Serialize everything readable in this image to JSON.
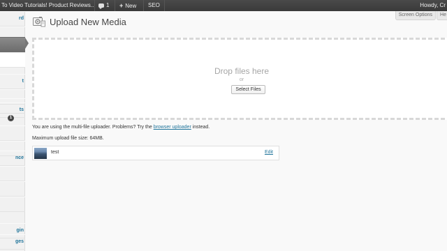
{
  "adminbar": {
    "site_title": "To Video Tutorials! Product Reviews...",
    "comments_count": "1",
    "new_label": "New",
    "seo_label": "SEO",
    "howdy": "Howdy, Cr"
  },
  "sidebar": {
    "items": [
      {
        "label": "rd"
      },
      {
        "label": ""
      },
      {
        "label": ""
      },
      {
        "label": ""
      },
      {
        "label": "t"
      },
      {
        "label": ""
      },
      {
        "label": ""
      },
      {
        "label": "ts"
      },
      {
        "label": ""
      },
      {
        "label": ""
      },
      {
        "label": "nce"
      },
      {
        "label": ""
      },
      {
        "label": ""
      },
      {
        "label": ""
      },
      {
        "label": "gin"
      },
      {
        "label": "ges"
      }
    ],
    "comments_badge": "1"
  },
  "screen_options": {
    "label": "Screen Options",
    "help_label": "He"
  },
  "page": {
    "title": "Upload New Media",
    "icon": "media-upload-icon"
  },
  "uploader": {
    "drop_text": "Drop files here",
    "or_text": "or",
    "select_button": "Select Files"
  },
  "info": {
    "multi_prefix": "You are using the multi-file uploader. Problems? Try the",
    "browser_link": "browser uploader",
    "multi_suffix": "instead.",
    "max_size": "Maximum upload file size: 64MB."
  },
  "media_items": [
    {
      "name": "test",
      "edit_label": "Edit"
    }
  ],
  "colors": {
    "admin_bar": "#464646",
    "link": "#21759b",
    "background": "#f9f9f9"
  }
}
